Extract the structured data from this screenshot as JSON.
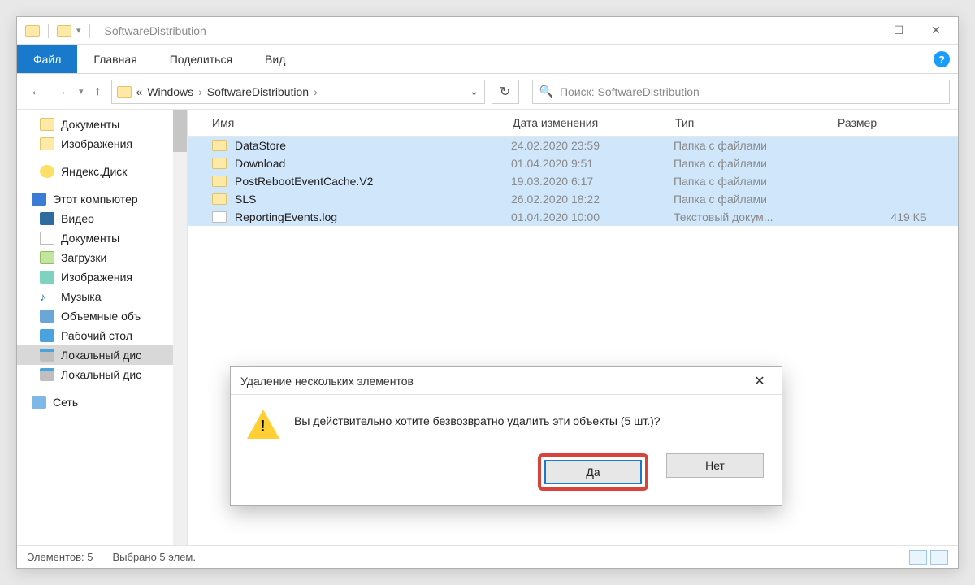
{
  "titlebar": {
    "title": "SoftwareDistribution"
  },
  "ribbon": {
    "file": "Файл",
    "tabs": [
      "Главная",
      "Поделиться",
      "Вид"
    ]
  },
  "address": {
    "prefix": "«",
    "crumbs": [
      "Windows",
      "SoftwareDistribution"
    ]
  },
  "search": {
    "placeholder": "Поиск: SoftwareDistribution"
  },
  "sidebar": {
    "items": [
      {
        "label": "Документы"
      },
      {
        "label": "Изображения"
      },
      {
        "label": "Яндекс.Диск"
      },
      {
        "label": "Этот компьютер"
      },
      {
        "label": "Видео"
      },
      {
        "label": "Документы"
      },
      {
        "label": "Загрузки"
      },
      {
        "label": "Изображения"
      },
      {
        "label": "Музыка"
      },
      {
        "label": "Объемные объ"
      },
      {
        "label": "Рабочий стол"
      },
      {
        "label": "Локальный дис"
      },
      {
        "label": "Локальный дис"
      },
      {
        "label": "Сеть"
      }
    ]
  },
  "columns": {
    "name": "Имя",
    "date": "Дата изменения",
    "type": "Тип",
    "size": "Размер"
  },
  "files": [
    {
      "name": "DataStore",
      "date": "24.02.2020 23:59",
      "type": "Папка с файлами",
      "size": "",
      "kind": "folder"
    },
    {
      "name": "Download",
      "date": "01.04.2020 9:51",
      "type": "Папка с файлами",
      "size": "",
      "kind": "folder"
    },
    {
      "name": "PostRebootEventCache.V2",
      "date": "19.03.2020 6:17",
      "type": "Папка с файлами",
      "size": "",
      "kind": "folder"
    },
    {
      "name": "SLS",
      "date": "26.02.2020 18:22",
      "type": "Папка с файлами",
      "size": "",
      "kind": "folder"
    },
    {
      "name": "ReportingEvents.log",
      "date": "01.04.2020 10:00",
      "type": "Текстовый докум...",
      "size": "419 КБ",
      "kind": "file"
    }
  ],
  "dialog": {
    "title": "Удаление нескольких элементов",
    "message": "Вы действительно хотите безвозвратно удалить эти объекты (5 шт.)?",
    "yes": "Да",
    "no": "Нет"
  },
  "status": {
    "count": "Элементов: 5",
    "selected": "Выбрано 5 элем."
  }
}
